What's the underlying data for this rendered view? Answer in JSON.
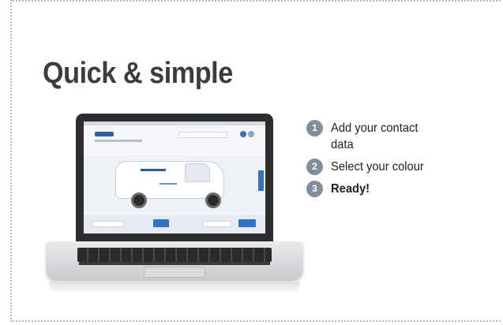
{
  "title": "Quick & simple",
  "steps": [
    {
      "number": "1",
      "line1": "Add your contact",
      "line2": "data",
      "bold": false
    },
    {
      "number": "2",
      "line1": "Select your colour",
      "line2": "",
      "bold": false
    },
    {
      "number": "3",
      "line1": "Ready!",
      "line2": "",
      "bold": true
    }
  ],
  "colors": {
    "title": "#3c3c3c",
    "step_badge": "#7f8f9d",
    "frame_dots": "#b9b9b9",
    "screen_accent": "#2f73c9"
  },
  "illustration": {
    "device": "laptop-icon",
    "screen_content": "van-configurator-screenshot"
  }
}
